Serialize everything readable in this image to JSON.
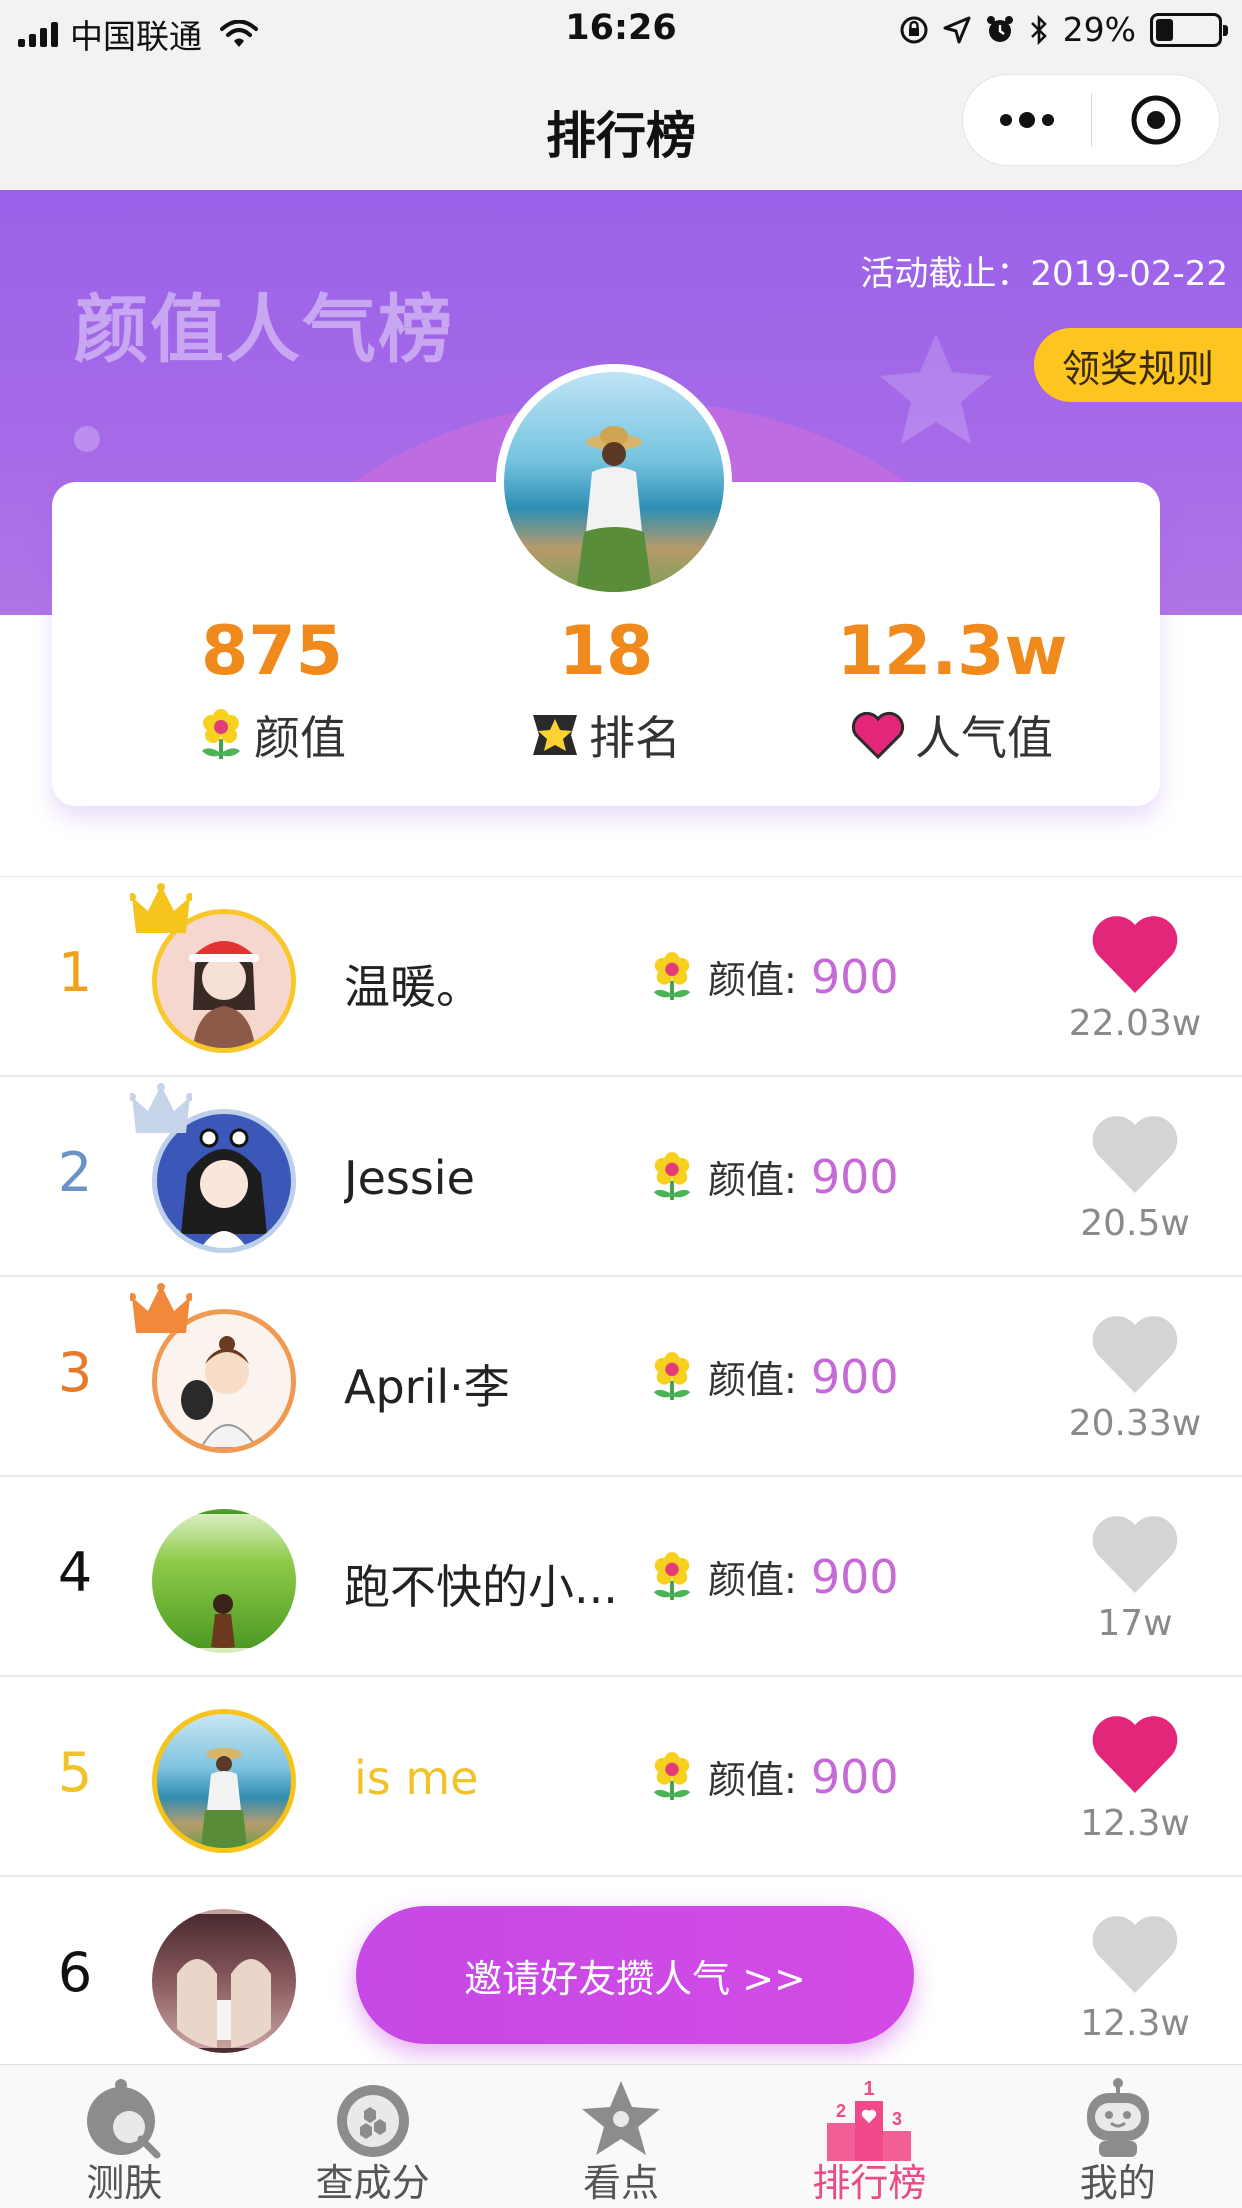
{
  "status_bar": {
    "carrier": "中国联通",
    "time": "16:26",
    "battery": "29%",
    "battery_level": 0.29
  },
  "nav": {
    "title": "排行榜"
  },
  "banner": {
    "title": "颜值人气榜",
    "deadline": "活动截止：2019-02-22",
    "rules_button": "领奖规则"
  },
  "stats": [
    {
      "value": "875",
      "label": "颜值",
      "icon": "flower-icon"
    },
    {
      "value": "18",
      "label": "排名",
      "icon": "star-badge-icon"
    },
    {
      "value": "12.3w",
      "label": "人气值",
      "icon": "heart-icon"
    }
  ],
  "colors": {
    "accent": "#9b62e9",
    "orange": "#f08a1c",
    "pink": "#e4267a",
    "gold": "#fec521",
    "score": "#c56ad6",
    "tab_active": "#ea4a86"
  },
  "ranking": [
    {
      "rank": "1",
      "name": "温暖。",
      "score_label": "颜值:",
      "score": "900",
      "likes": "22.03w",
      "liked": true
    },
    {
      "rank": "2",
      "name": "Jessie",
      "score_label": "颜值:",
      "score": "900",
      "likes": "20.5w",
      "liked": false
    },
    {
      "rank": "3",
      "name": "April·李",
      "score_label": "颜值:",
      "score": "900",
      "likes": "20.33w",
      "liked": false
    },
    {
      "rank": "4",
      "name": "跑不快的小...",
      "score_label": "颜值:",
      "score": "900",
      "likes": "17w",
      "liked": false
    },
    {
      "rank": "5",
      "name": "is me",
      "score_label": "颜值:",
      "score": "900",
      "likes": "12.3w",
      "liked": true
    },
    {
      "rank": "6",
      "name": "",
      "score_label": "",
      "score": "",
      "likes": "12.3w",
      "liked": false
    }
  ],
  "invite_button": "邀请好友攒人气 >>",
  "tabs": [
    {
      "label": "测肤",
      "icon": "skin-test-icon"
    },
    {
      "label": "查成分",
      "icon": "ingredients-icon"
    },
    {
      "label": "看点",
      "icon": "highlights-icon"
    },
    {
      "label": "排行榜",
      "icon": "podium-icon",
      "active": true
    },
    {
      "label": "我的",
      "icon": "profile-robot-icon"
    }
  ]
}
